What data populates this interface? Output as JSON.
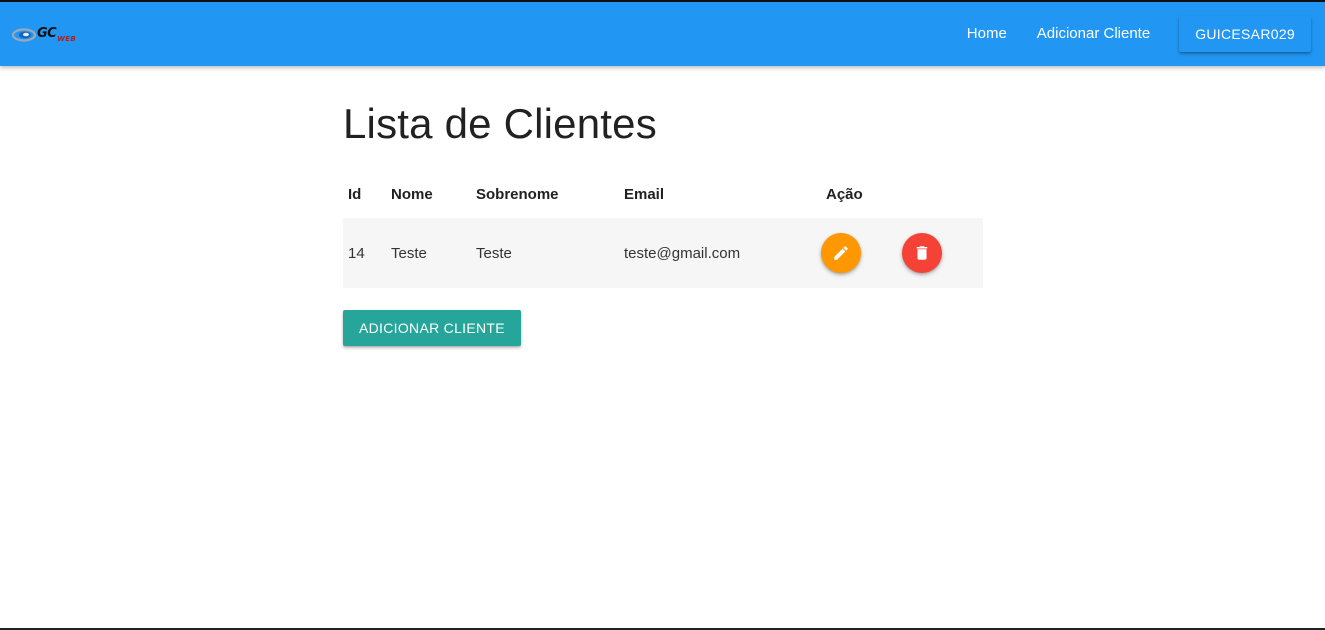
{
  "navbar": {
    "brand_text": "GC",
    "brand_sub": "WEB",
    "links": [
      "Home",
      "Adicionar Cliente"
    ],
    "user_button": "GUICESAR029",
    "color": "#2196f3"
  },
  "page": {
    "title": "Lista de Clientes"
  },
  "table": {
    "columns": [
      "Id",
      "Nome",
      "Sobrenome",
      "Email",
      "Ação"
    ],
    "rows": [
      {
        "id": "14",
        "nome": "Teste",
        "sobrenome": "Teste",
        "email": "teste@gmail.com",
        "actions": [
          "pencil-icon",
          "trash-icon"
        ]
      }
    ]
  },
  "add_button": {
    "label": "ADICIONAR CLIENTE",
    "color": "#26a69a"
  },
  "colors": {
    "edit": "#ff9800",
    "delete": "#f44336"
  }
}
